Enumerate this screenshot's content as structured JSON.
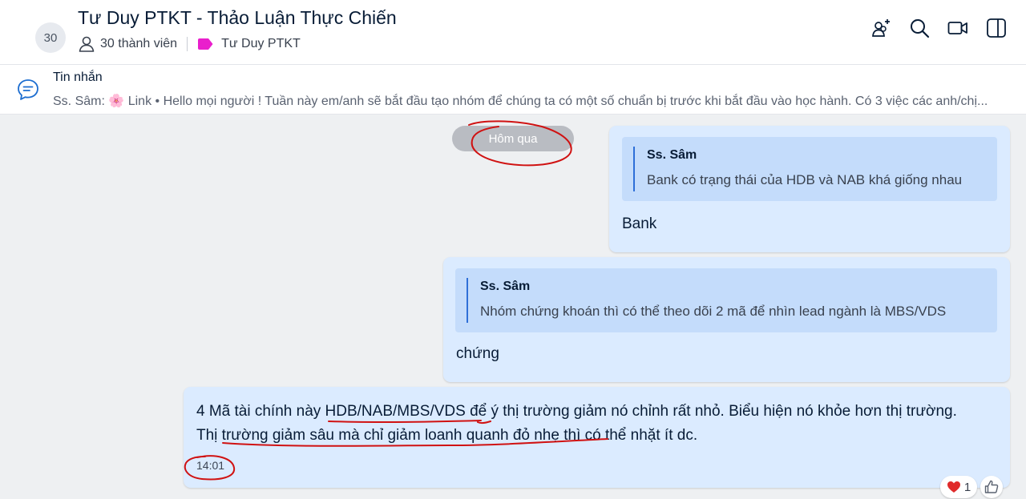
{
  "header": {
    "avatar_count": "30",
    "title": "Tư Duy PTKT - Thảo Luận Thực Chiến",
    "member_count": "30 thành viên",
    "tag_label": "Tư Duy PTKT",
    "tag_color": "#e91fcc",
    "icons": [
      "add-member-icon",
      "search-icon",
      "video-call-icon",
      "sidebar-toggle-icon"
    ]
  },
  "pinned": {
    "title": "Tin nhắn",
    "text": "Ss. Sâm: 🌸 Link • Hello mọi người ! Tuần này em/anh sẽ bắt đầu tạo nhóm để chúng ta có một số chuẩn bị trước khi bắt đầu vào học hành. Có 3 việc các anh/chị..."
  },
  "chat": {
    "date_divider": "Hôm qua",
    "messages": [
      {
        "quote_author": "Ss. Sâm",
        "quote_text": "Bank có trạng thái của HDB và NAB khá giống nhau",
        "text": "Bank"
      },
      {
        "quote_author": "Ss. Sâm",
        "quote_text": "Nhóm chứng khoán thì có thể theo dõi 2 mã để nhìn lead ngành là MBS/VDS",
        "text": "chứng"
      },
      {
        "line1": "4 Mã tài chính này HDB/NAB/MBS/VDS để ý thị trường giảm nó chỉnh rất nhỏ. Biểu hiện nó khỏe hơn thị trường.",
        "line2": "Thị trường giảm sâu mà chỉ giảm loanh quanh đỏ nhẹ thì có thể nhặt ít dc.",
        "time": "14:01",
        "reaction_count": "1"
      }
    ]
  },
  "colors": {
    "bubble": "#dbebff",
    "quote_bg": "#c4dcfb",
    "chat_bg": "#eef0f2",
    "annotation": "#d01212"
  }
}
